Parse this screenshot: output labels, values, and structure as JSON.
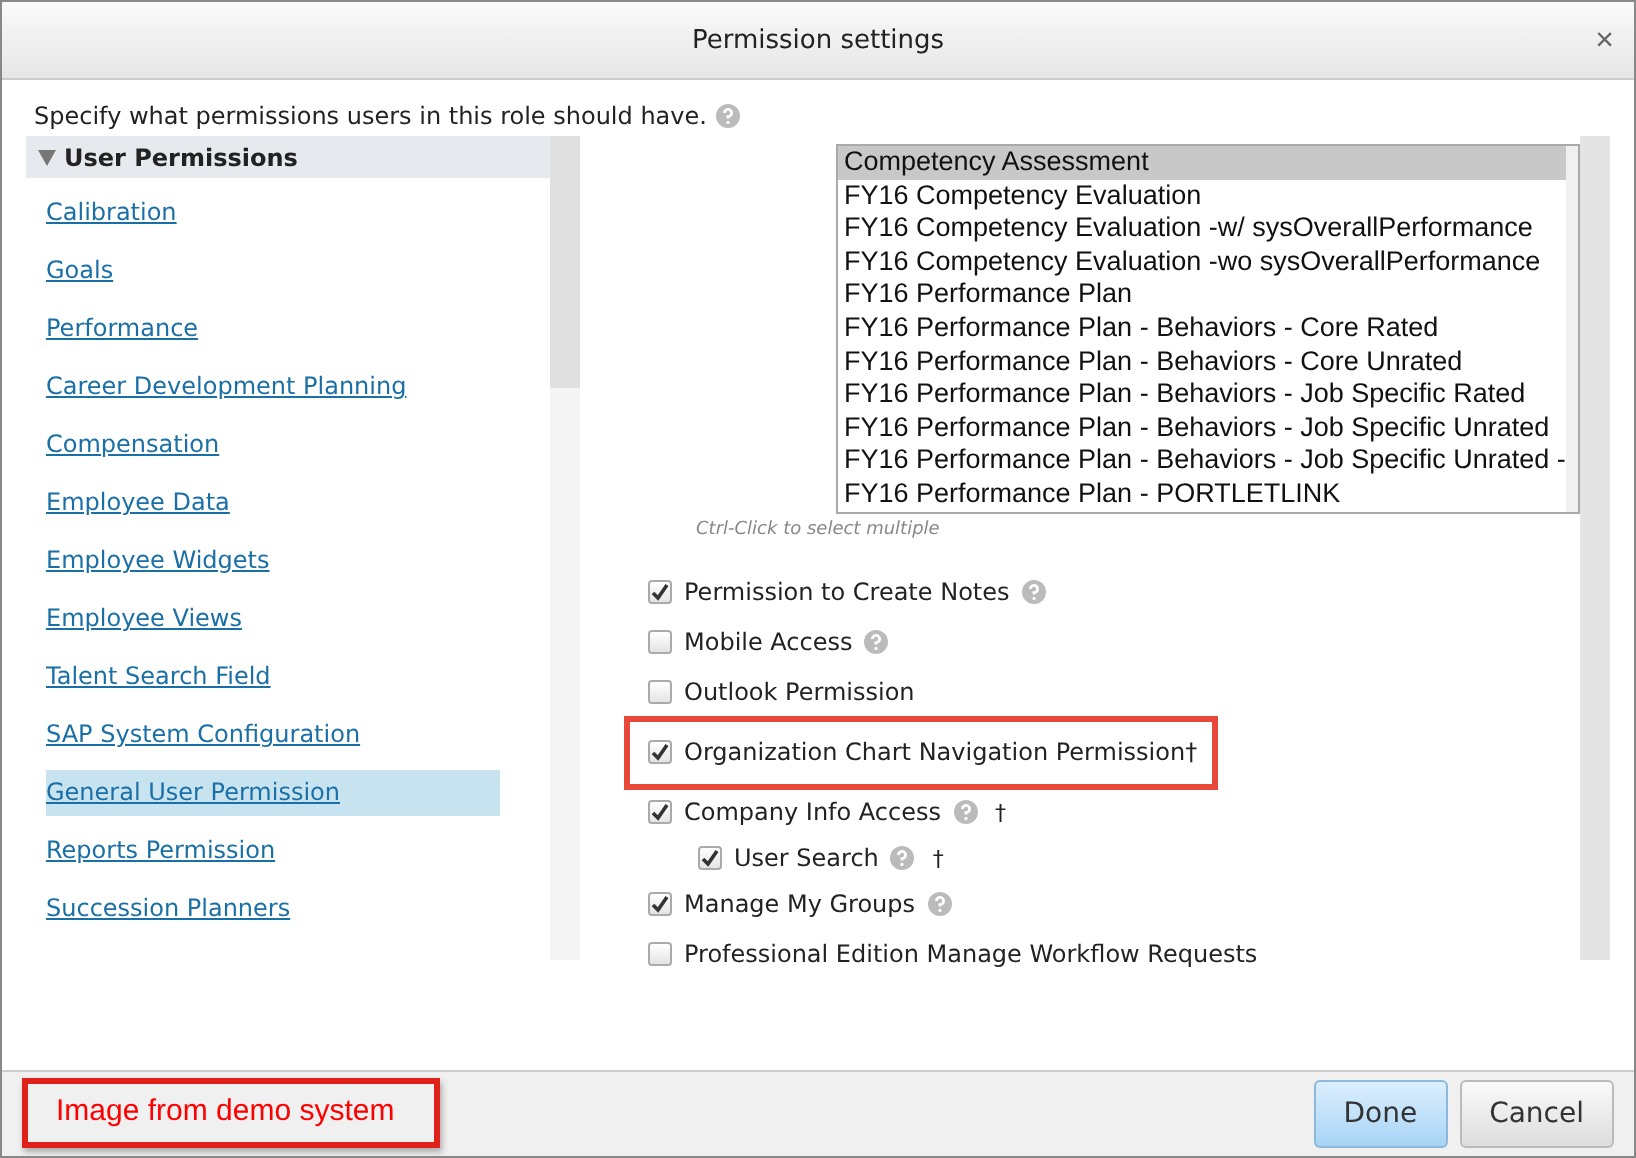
{
  "window": {
    "title": "Permission settings",
    "close": "×"
  },
  "intro": "Specify what permissions users in this role should have.",
  "sidebar": {
    "header": "User Permissions",
    "expanded": true,
    "items": [
      {
        "label": "Calibration",
        "selected": false
      },
      {
        "label": "Goals",
        "selected": false
      },
      {
        "label": "Performance",
        "selected": false
      },
      {
        "label": "Career Development Planning",
        "selected": false
      },
      {
        "label": "Compensation",
        "selected": false
      },
      {
        "label": "Employee Data",
        "selected": false
      },
      {
        "label": "Employee Widgets",
        "selected": false
      },
      {
        "label": "Employee Views",
        "selected": false
      },
      {
        "label": "Talent Search Field",
        "selected": false
      },
      {
        "label": "SAP System Configuration",
        "selected": false
      },
      {
        "label": "General User Permission",
        "selected": true
      },
      {
        "label": "Reports Permission",
        "selected": false
      },
      {
        "label": "Succession Planners",
        "selected": false
      }
    ]
  },
  "listbox": {
    "items": [
      {
        "label": "Competency Assessment",
        "selected": true
      },
      {
        "label": "FY16 Competency Evaluation",
        "selected": false
      },
      {
        "label": "FY16 Competency Evaluation -w/ sysOverallPerformance",
        "selected": false
      },
      {
        "label": "FY16 Competency Evaluation -wo sysOverallPerformance",
        "selected": false
      },
      {
        "label": "FY16 Performance Plan",
        "selected": false
      },
      {
        "label": "FY16 Performance Plan - Behaviors - Core Rated",
        "selected": false
      },
      {
        "label": "FY16 Performance Plan - Behaviors - Core Unrated",
        "selected": false
      },
      {
        "label": "FY16 Performance Plan - Behaviors - Job Specific Rated",
        "selected": false
      },
      {
        "label": "FY16 Performance Plan - Behaviors - Job Specific Unrated",
        "selected": false
      },
      {
        "label": "FY16 Performance Plan - Behaviors - Job Specific Unrated -",
        "selected": false
      },
      {
        "label": "FY16 Performance Plan - PORTLETLINK",
        "selected": false
      }
    ],
    "hint": "Ctrl-Click to select multiple"
  },
  "permissions": [
    {
      "label": "Permission to Create Notes",
      "checked": true,
      "help": true,
      "highlighted": false
    },
    {
      "label": "Mobile Access",
      "checked": false,
      "help": true,
      "highlighted": false
    },
    {
      "label": "Outlook Permission",
      "checked": false,
      "help": false,
      "highlighted": false
    },
    {
      "label": "Organization Chart Navigation Permission†",
      "checked": true,
      "help": false,
      "highlighted": true
    },
    {
      "label": "Company Info Access",
      "checked": true,
      "help": true,
      "dagger": "†",
      "highlighted": false,
      "children": [
        {
          "label": "User Search",
          "checked": true,
          "help": true,
          "dagger": "†",
          "highlighted": false
        }
      ]
    },
    {
      "label": "Manage My Groups",
      "checked": true,
      "help": true,
      "highlighted": false
    },
    {
      "label": "Professional Edition Manage Workflow Requests",
      "checked": false,
      "help": false,
      "highlighted": false
    }
  ],
  "footer": {
    "note": "Image from demo system",
    "buttons": [
      {
        "label": "Done",
        "kind": "primary"
      },
      {
        "label": "Cancel",
        "kind": "secondary"
      }
    ]
  }
}
